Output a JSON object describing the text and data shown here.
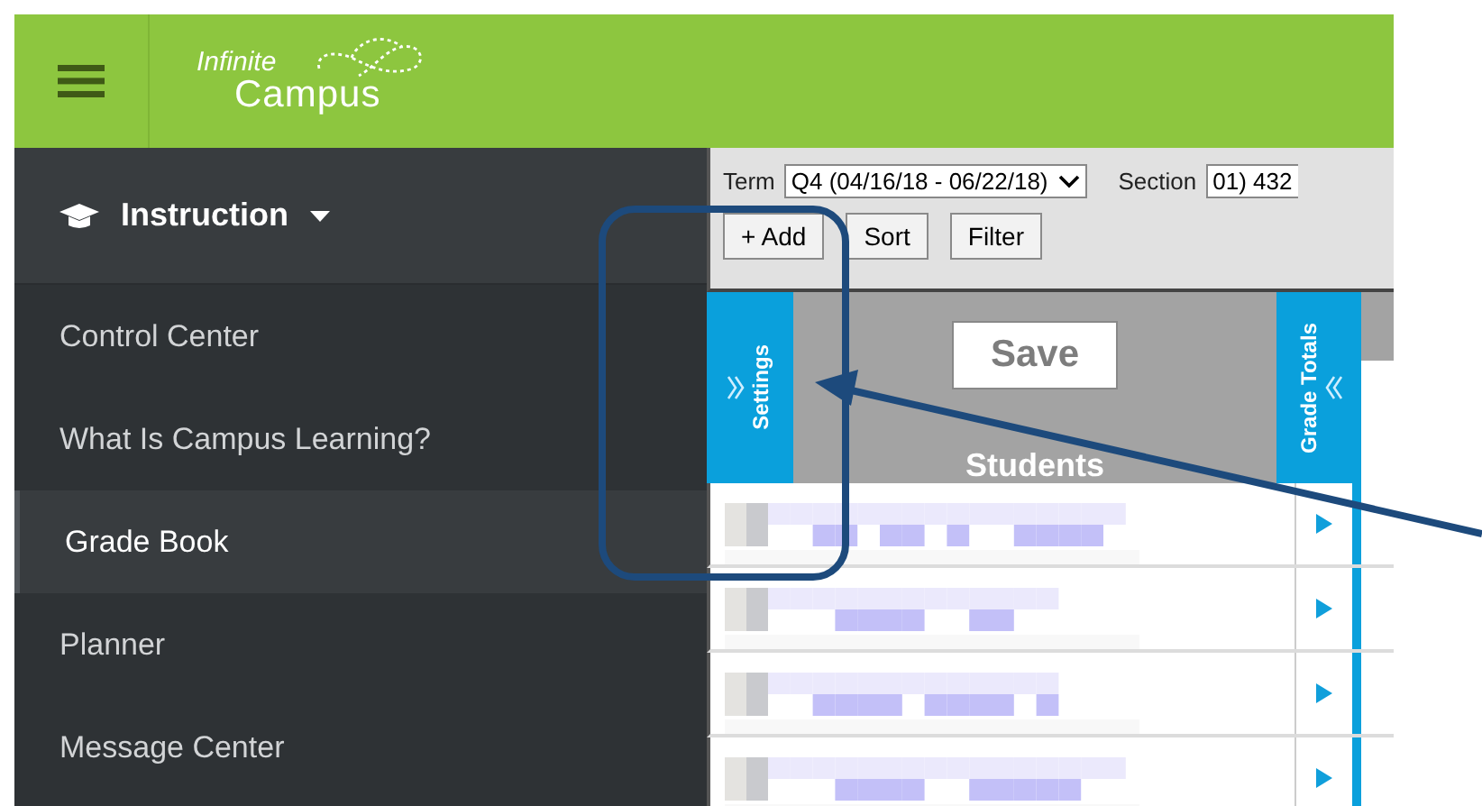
{
  "header": {
    "logo_line_1": "Infinite",
    "logo_line_2": "Campus"
  },
  "sidebar": {
    "section": "Instruction",
    "items": [
      {
        "label": "Control Center",
        "selected": false
      },
      {
        "label": "What Is Campus Learning?",
        "selected": false
      },
      {
        "label": "Grade Book",
        "selected": true
      },
      {
        "label": "Planner",
        "selected": false
      },
      {
        "label": "Message Center",
        "selected": false
      }
    ]
  },
  "toolbar": {
    "term_label": "Term",
    "term_value": "Q4 (04/16/18 - 06/22/18)",
    "section_label": "Section",
    "section_value": "01) 432",
    "buttons": [
      "+ Add",
      "Sort",
      "Filter"
    ]
  },
  "grid": {
    "settings_tab": "Settings",
    "save": "Save",
    "students_header": "Students",
    "totals_tab": "Grade Totals",
    "rows": [
      {
        "kind": "student"
      },
      {
        "kind": "student"
      },
      {
        "kind": "student"
      },
      {
        "kind": "student"
      }
    ]
  }
}
